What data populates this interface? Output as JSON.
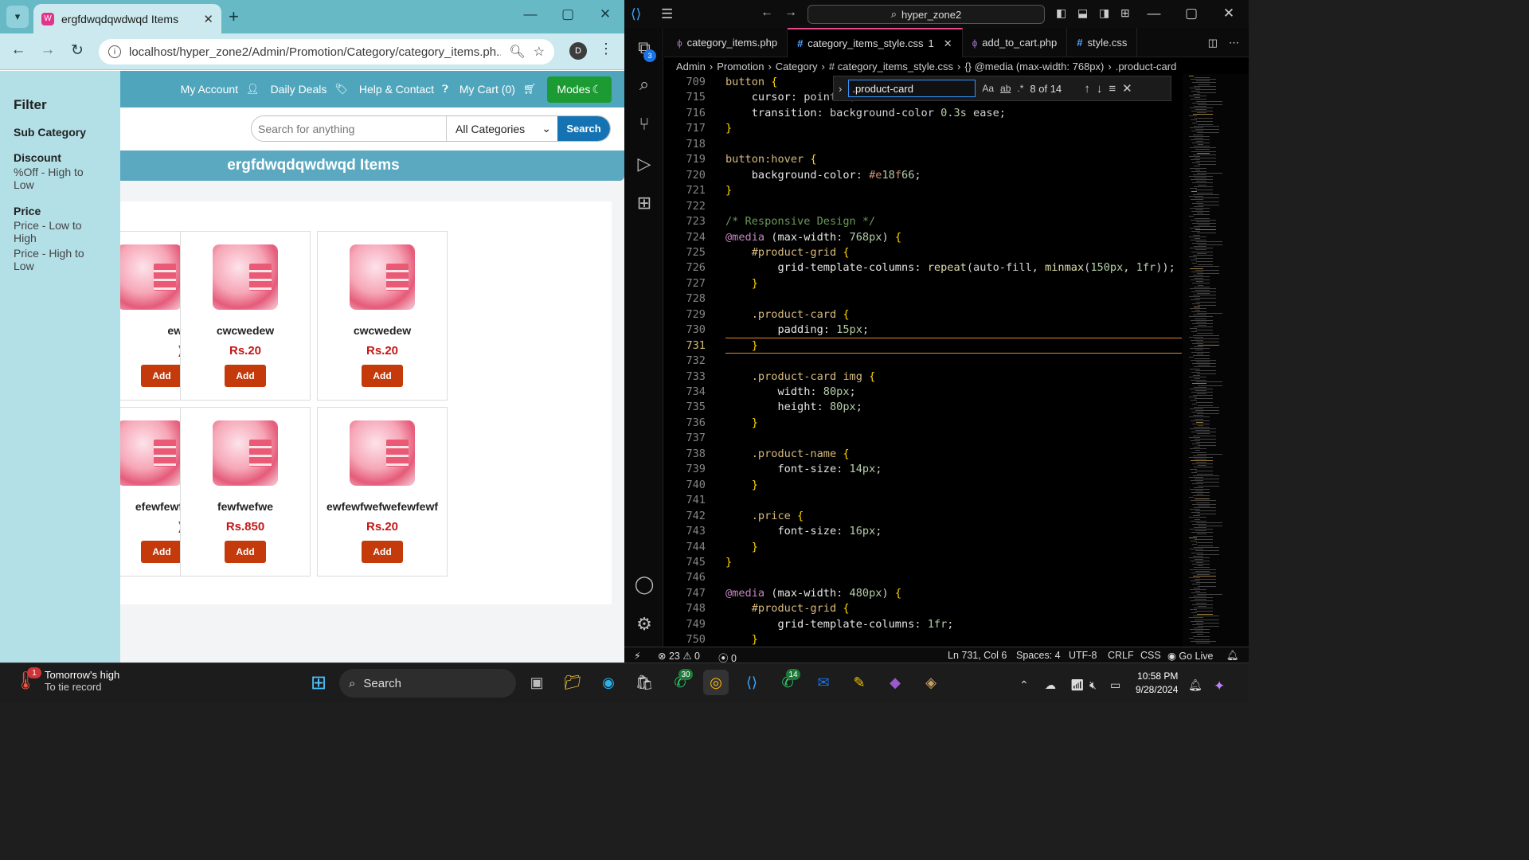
{
  "browser": {
    "tab_title": "ergfdwqdqwdwqd Items",
    "url": "localhost/hyper_zone2/Admin/Promotion/Category/category_items.ph...",
    "profile_initial": "D"
  },
  "site": {
    "nav": [
      "My Account",
      "Daily Deals",
      "Help & Contact",
      "My Cart (0)"
    ],
    "modes_label": "Modes",
    "search_placeholder": "Search for anything",
    "category_select": "All Categories",
    "search_button": "Search",
    "banner": "ergfdwqdqwdwqd Items",
    "sidebar": {
      "title": "Filter",
      "sub_category": "Sub Category",
      "discount": "Discount",
      "discount_option": "%Off - High to Low",
      "price": "Price",
      "price_options": [
        "Price - Low to High",
        "Price - High to Low"
      ]
    },
    "products": [
      {
        "name": "ew",
        "price": ")",
        "button": "Add"
      },
      {
        "name": "cwcwedew",
        "price": "Rs.20",
        "button": "Add"
      },
      {
        "name": "cwcwedew",
        "price": "Rs.20",
        "button": "Add"
      },
      {
        "name": "efewfewf",
        "price": ")",
        "button": "Add"
      },
      {
        "name": "fewfwefwe",
        "price": "Rs.850",
        "button": "Add"
      },
      {
        "name": "ewfewfwefwefewfewf",
        "price": "Rs.20",
        "button": "Add"
      }
    ]
  },
  "vscode": {
    "command_center": "hyper_zone2",
    "explorer_badge": "3",
    "tabs": [
      {
        "icon": "php",
        "label": "category_items.php"
      },
      {
        "icon": "#",
        "label": "category_items_style.css",
        "badge": "1",
        "active": true
      },
      {
        "icon": "php",
        "label": "add_to_cart.php"
      },
      {
        "icon": "#",
        "label": "style.css"
      }
    ],
    "breadcrumbs": [
      "Admin",
      "Promotion",
      "Category",
      "# category_items_style.css",
      "{} @media (max-width: 768px)",
      ".product-card"
    ],
    "find": {
      "query": ".product-card",
      "count": "8 of 14",
      "opt_case": "Aa",
      "opt_word": "ab",
      "opt_regex": ".*"
    },
    "lines": [
      {
        "n": "709",
        "t": "button {"
      },
      {
        "n": "715",
        "t": "    cursor: pointer;"
      },
      {
        "n": "716",
        "t": "    transition: background-color 0.3s ease;"
      },
      {
        "n": "717",
        "t": "}"
      },
      {
        "n": "718",
        "t": ""
      },
      {
        "n": "719",
        "t": "button:hover {"
      },
      {
        "n": "720",
        "t": "    background-color: #e18f66;"
      },
      {
        "n": "721",
        "t": "}"
      },
      {
        "n": "722",
        "t": ""
      },
      {
        "n": "723",
        "t": "/* Responsive Design */"
      },
      {
        "n": "724",
        "t": "@media (max-width: 768px) {"
      },
      {
        "n": "725",
        "t": "    #product-grid {"
      },
      {
        "n": "726",
        "t": "        grid-template-columns: repeat(auto-fill, minmax(150px, 1fr));"
      },
      {
        "n": "727",
        "t": "    }"
      },
      {
        "n": "728",
        "t": ""
      },
      {
        "n": "729",
        "t": "    .product-card {"
      },
      {
        "n": "730",
        "t": "        padding: 15px;"
      },
      {
        "n": "731",
        "t": "    }"
      },
      {
        "n": "732",
        "t": ""
      },
      {
        "n": "733",
        "t": "    .product-card img {"
      },
      {
        "n": "734",
        "t": "        width: 80px;"
      },
      {
        "n": "735",
        "t": "        height: 80px;"
      },
      {
        "n": "736",
        "t": "    }"
      },
      {
        "n": "737",
        "t": ""
      },
      {
        "n": "738",
        "t": "    .product-name {"
      },
      {
        "n": "739",
        "t": "        font-size: 14px;"
      },
      {
        "n": "740",
        "t": "    }"
      },
      {
        "n": "741",
        "t": ""
      },
      {
        "n": "742",
        "t": "    .price {"
      },
      {
        "n": "743",
        "t": "        font-size: 16px;"
      },
      {
        "n": "744",
        "t": "    }"
      },
      {
        "n": "745",
        "t": "}"
      },
      {
        "n": "746",
        "t": ""
      },
      {
        "n": "747",
        "t": "@media (max-width: 480px) {"
      },
      {
        "n": "748",
        "t": "    #product-grid {"
      },
      {
        "n": "749",
        "t": "        grid-template-columns: 1fr;"
      },
      {
        "n": "750",
        "t": "    }"
      },
      {
        "n": "751",
        "t": ""
      }
    ],
    "current_line": "731",
    "status": {
      "errors": "23",
      "warnings": "0",
      "ports": "0",
      "position": "Ln 731, Col 6",
      "spaces": "Spaces: 4",
      "encoding": "UTF-8",
      "eol": "CRLF",
      "language": "CSS",
      "golive": "Go Live"
    }
  },
  "taskbar": {
    "weather_title": "Tomorrow's high",
    "weather_sub": "To tie record",
    "weather_badge": "1",
    "search": "Search",
    "whatsapp_badge": "30",
    "whatsapp2_badge": "14",
    "time": "10:58 PM",
    "date": "9/28/2024"
  },
  "colors": {
    "accent_pink": "#e64a8e",
    "add_button": "#c43a0b",
    "price_red": "#c41717",
    "nav_teal": "#4fa6bc"
  }
}
